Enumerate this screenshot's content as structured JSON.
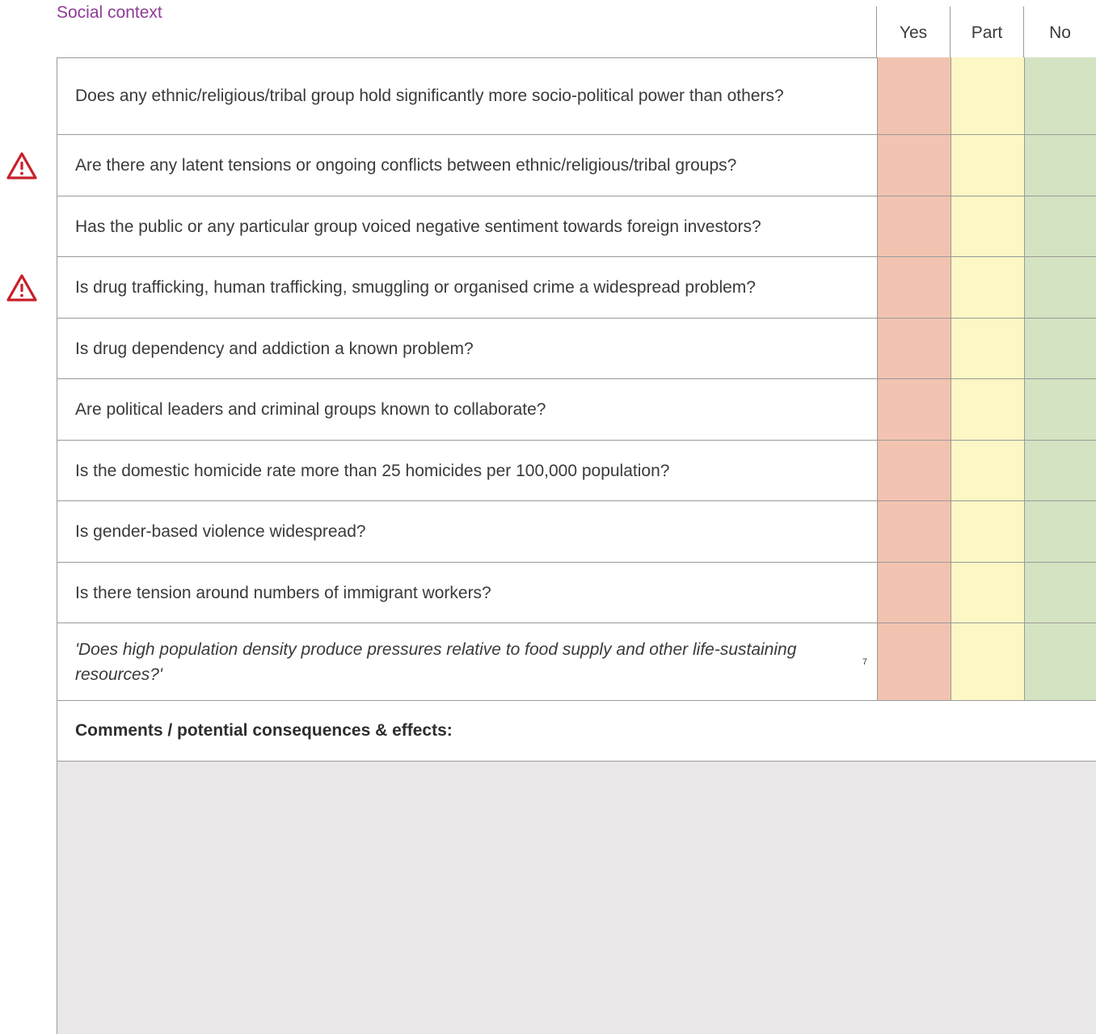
{
  "section_title": "Social context",
  "columns": [
    "Yes",
    "Part",
    "No"
  ],
  "colors": {
    "yes": "#f2c3b0",
    "part": "#fdf6c5",
    "no": "#d4e3c2",
    "warning": "#c8202a",
    "title": "#8e3c96"
  },
  "questions": [
    {
      "text": "Does any ethnic/religious/tribal group hold significantly more socio-political power than others?",
      "warning": false,
      "italic": false
    },
    {
      "text": "Are there any latent tensions or ongoing conflicts between ethnic/religious/tribal groups?",
      "warning": true,
      "italic": false
    },
    {
      "text": "Has the public or any particular group voiced negative sentiment towards foreign investors?",
      "warning": false,
      "italic": false
    },
    {
      "text": "Is drug trafficking, human trafficking, smuggling or organised crime a widespread problem?",
      "warning": true,
      "italic": false
    },
    {
      "text": "Is drug dependency and addiction a known problem?",
      "warning": false,
      "italic": false
    },
    {
      "text": "Are political leaders and criminal groups known to collaborate?",
      "warning": false,
      "italic": false
    },
    {
      "text": "Is the domestic homicide rate more than 25 homicides per 100,000 population?",
      "warning": false,
      "italic": false
    },
    {
      "text": "Is gender-based violence widespread?",
      "warning": false,
      "italic": false
    },
    {
      "text": "Is there tension around numbers of immigrant workers?",
      "warning": false,
      "italic": false
    },
    {
      "text": "'Does high population density produce pressures relative to food supply and other life-sustaining resources?'",
      "footnote": "7",
      "warning": false,
      "italic": true
    }
  ],
  "comments_label": "Comments / potential consequences & effects:",
  "comments_value": ""
}
